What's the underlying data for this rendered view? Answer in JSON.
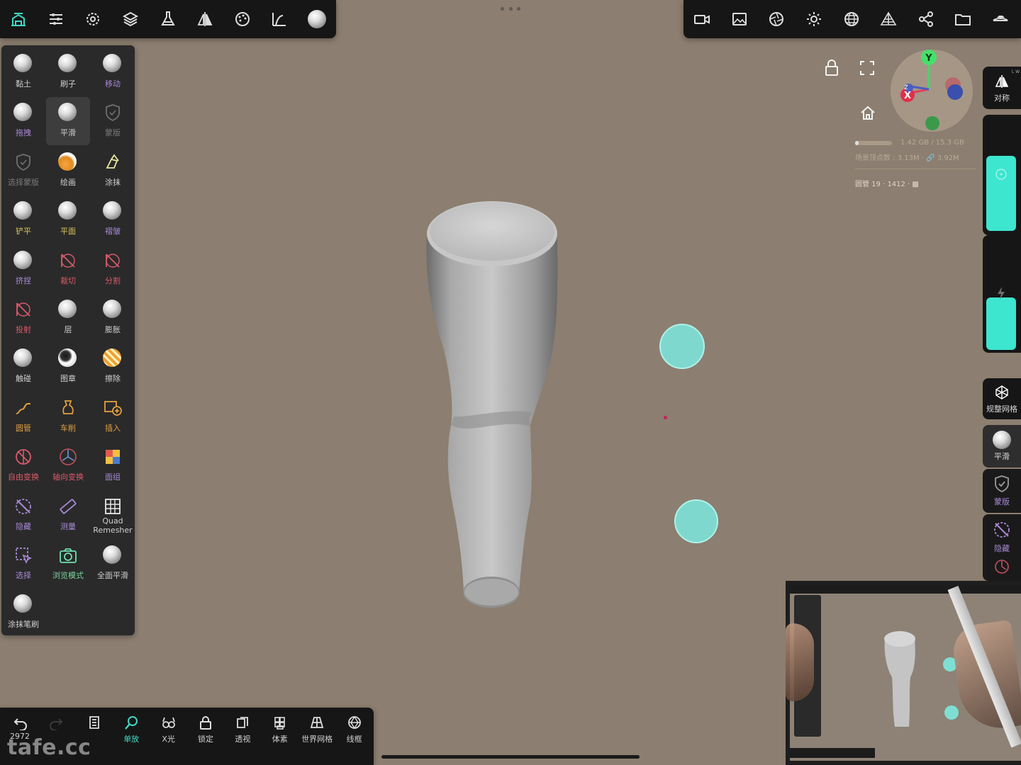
{
  "top_left_toolbar": {
    "items": [
      {
        "name": "scene-icon"
      },
      {
        "name": "settings-sliders-icon"
      },
      {
        "name": "gear-icon"
      },
      {
        "name": "layers-icon"
      },
      {
        "name": "flask-icon"
      },
      {
        "name": "symmetry-icon"
      },
      {
        "name": "palette-icon"
      },
      {
        "name": "topology-icon"
      },
      {
        "name": "brush-ball-icon"
      }
    ]
  },
  "top_right_toolbar": {
    "items": [
      {
        "name": "camera-icon"
      },
      {
        "name": "image-icon"
      },
      {
        "name": "aperture-icon"
      },
      {
        "name": "sun-icon"
      },
      {
        "name": "sphere-grid-icon"
      },
      {
        "name": "mesh-pyramid-icon"
      },
      {
        "name": "share-icon"
      },
      {
        "name": "folder-icon"
      },
      {
        "name": "hide-icon"
      }
    ]
  },
  "tools": [
    {
      "label": "黏土",
      "color": "white"
    },
    {
      "label": "刷子",
      "color": "white"
    },
    {
      "label": "移动",
      "color": "purple"
    },
    {
      "label": "拖拽",
      "color": "purple"
    },
    {
      "label": "平滑",
      "color": "white"
    },
    {
      "label": "蒙版",
      "color": "dim"
    },
    {
      "label": "选择蒙版",
      "color": "dim"
    },
    {
      "label": "绘画",
      "color": "white"
    },
    {
      "label": "涂抹",
      "color": "white"
    },
    {
      "label": "铲平",
      "color": "yellow"
    },
    {
      "label": "平面",
      "color": "yellow"
    },
    {
      "label": "褶皱",
      "color": "purple"
    },
    {
      "label": "挤捏",
      "color": "purple"
    },
    {
      "label": "裁切",
      "color": "red"
    },
    {
      "label": "分割",
      "color": "red"
    },
    {
      "label": "投射",
      "color": "red"
    },
    {
      "label": "层",
      "color": "white"
    },
    {
      "label": "膨胀",
      "color": "white"
    },
    {
      "label": "触碰",
      "color": "white"
    },
    {
      "label": "图章",
      "color": "white"
    },
    {
      "label": "擦除",
      "color": "white"
    },
    {
      "label": "圆管",
      "color": "orange"
    },
    {
      "label": "车削",
      "color": "orange"
    },
    {
      "label": "插入",
      "color": "orange"
    },
    {
      "label": "自由变换",
      "color": "red"
    },
    {
      "label": "轴向变换",
      "color": "red"
    },
    {
      "label": "面组",
      "color": "purple"
    },
    {
      "label": "隐藏",
      "color": "purple"
    },
    {
      "label": "测量",
      "color": "purple"
    },
    {
      "label": "Quad Remesher",
      "color": "white"
    },
    {
      "label": "选择",
      "color": "purple"
    },
    {
      "label": "浏览模式",
      "color": "green"
    },
    {
      "label": "全面平滑",
      "color": "white"
    },
    {
      "label": "涂抹笔刷",
      "color": "white"
    }
  ],
  "bottom_bar": {
    "undo_count": "2972",
    "items": [
      {
        "label": "",
        "name": "undo-button"
      },
      {
        "label": "",
        "name": "redo-button"
      },
      {
        "label": "",
        "name": "history-button"
      },
      {
        "label": "单放",
        "name": "single-button",
        "active": true
      },
      {
        "label": "X光",
        "name": "xray-button"
      },
      {
        "label": "锁定",
        "name": "lock-button"
      },
      {
        "label": "透视",
        "name": "perspective-button"
      },
      {
        "label": "体素",
        "name": "voxel-button"
      },
      {
        "label": "世界网格",
        "name": "world-grid-button"
      },
      {
        "label": "线框",
        "name": "wireframe-button"
      }
    ]
  },
  "right_panel": {
    "symmetry_label": "对称",
    "symmetry_badge": "L W",
    "remesh_label": "规整网格",
    "smooth_label": "平滑",
    "mask_label": "蒙版",
    "hide_label": "隐藏"
  },
  "gizmo": {
    "y_label": "Y",
    "x_label": "X",
    "z_label": "Z"
  },
  "viewport_info": {
    "memory": "1.42 GB / 15.3 GB",
    "vertices": "场景顶点数 : 3.13M · 🔗 3.92M",
    "object": "圆管 19 · 1412 · ▩"
  },
  "watermark": "tafe.cc",
  "colors": {
    "accent": "#3de6cf",
    "background": "#8c7e70",
    "panel": "#2a2a2a",
    "toolbar": "#161616"
  }
}
